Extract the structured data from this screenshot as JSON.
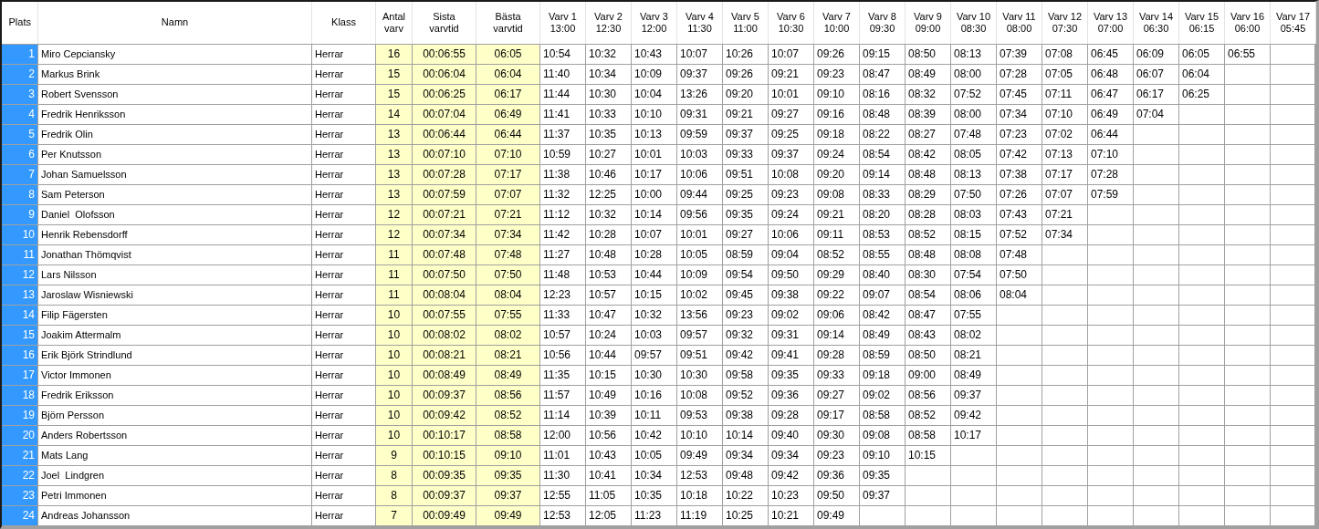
{
  "table": {
    "columns": [
      {
        "kind": "rowhead",
        "lines": [
          "Plats"
        ]
      },
      {
        "kind": "text",
        "lines": [
          "Namn"
        ]
      },
      {
        "kind": "text",
        "lines": [
          "Klass"
        ]
      },
      {
        "kind": "stat",
        "lines": [
          "Antal",
          "varv"
        ]
      },
      {
        "kind": "stat",
        "lines": [
          "Sista",
          "varvtid"
        ]
      },
      {
        "kind": "stat",
        "lines": [
          "Bästa",
          "varvtid"
        ]
      },
      {
        "kind": "lap",
        "lines": [
          "Varv 1",
          "13:00"
        ]
      },
      {
        "kind": "lap",
        "lines": [
          "Varv 2",
          "12:30"
        ]
      },
      {
        "kind": "lap",
        "lines": [
          "Varv 3",
          "12:00"
        ]
      },
      {
        "kind": "lap",
        "lines": [
          "Varv 4",
          "11:30"
        ]
      },
      {
        "kind": "lap",
        "lines": [
          "Varv 5",
          "11:00"
        ]
      },
      {
        "kind": "lap",
        "lines": [
          "Varv 6",
          "10:30"
        ]
      },
      {
        "kind": "lap",
        "lines": [
          "Varv 7",
          "10:00"
        ]
      },
      {
        "kind": "lap",
        "lines": [
          "Varv 8",
          "09:30"
        ]
      },
      {
        "kind": "lap",
        "lines": [
          "Varv 9",
          "09:00"
        ]
      },
      {
        "kind": "lap",
        "lines": [
          "Varv 10",
          "08:30"
        ]
      },
      {
        "kind": "lap",
        "lines": [
          "Varv 11",
          "08:00"
        ]
      },
      {
        "kind": "lap",
        "lines": [
          "Varv 12",
          "07:30"
        ]
      },
      {
        "kind": "lap",
        "lines": [
          "Varv 13",
          "07:00"
        ]
      },
      {
        "kind": "lap",
        "lines": [
          "Varv 14",
          "06:30"
        ]
      },
      {
        "kind": "lap",
        "lines": [
          "Varv 15",
          "06:15"
        ]
      },
      {
        "kind": "lap",
        "lines": [
          "Varv 16",
          "06:00"
        ]
      },
      {
        "kind": "lap",
        "lines": [
          "Varv 17",
          "05:45"
        ]
      }
    ],
    "rows": [
      {
        "place": "1",
        "name": "Miro Cepciansky",
        "class": "Herrar",
        "laps": "16",
        "last": "00:06:55",
        "best": "06:05",
        "splits": [
          "10:54",
          "10:32",
          "10:43",
          "10:07",
          "10:26",
          "10:07",
          "09:26",
          "09:15",
          "08:50",
          "08:13",
          "07:39",
          "07:08",
          "06:45",
          "06:09",
          "06:05",
          "06:55"
        ]
      },
      {
        "place": "2",
        "name": "Markus Brink",
        "class": "Herrar",
        "laps": "15",
        "last": "00:06:04",
        "best": "06:04",
        "splits": [
          "11:40",
          "10:34",
          "10:09",
          "09:37",
          "09:26",
          "09:21",
          "09:23",
          "08:47",
          "08:49",
          "08:00",
          "07:28",
          "07:05",
          "06:48",
          "06:07",
          "06:04"
        ]
      },
      {
        "place": "3",
        "name": "Robert Svensson",
        "class": "Herrar",
        "laps": "15",
        "last": "00:06:25",
        "best": "06:17",
        "splits": [
          "11:44",
          "10:30",
          "10:04",
          "13:26",
          "09:20",
          "10:01",
          "09:10",
          "08:16",
          "08:32",
          "07:52",
          "07:45",
          "07:11",
          "06:47",
          "06:17",
          "06:25"
        ]
      },
      {
        "place": "4",
        "name": "Fredrik Henriksson",
        "class": "Herrar",
        "laps": "14",
        "last": "00:07:04",
        "best": "06:49",
        "splits": [
          "11:41",
          "10:33",
          "10:10",
          "09:31",
          "09:21",
          "09:27",
          "09:16",
          "08:48",
          "08:39",
          "08:00",
          "07:34",
          "07:10",
          "06:49",
          "07:04"
        ]
      },
      {
        "place": "5",
        "name": "Fredrik Olin",
        "class": "Herrar",
        "laps": "13",
        "last": "00:06:44",
        "best": "06:44",
        "splits": [
          "11:37",
          "10:35",
          "10:13",
          "09:59",
          "09:37",
          "09:25",
          "09:18",
          "08:22",
          "08:27",
          "07:48",
          "07:23",
          "07:02",
          "06:44"
        ]
      },
      {
        "place": "6",
        "name": "Per Knutsson",
        "class": "Herrar",
        "laps": "13",
        "last": "00:07:10",
        "best": "07:10",
        "splits": [
          "10:59",
          "10:27",
          "10:01",
          "10:03",
          "09:33",
          "09:37",
          "09:24",
          "08:54",
          "08:42",
          "08:05",
          "07:42",
          "07:13",
          "07:10"
        ]
      },
      {
        "place": "7",
        "name": "Johan Samuelsson",
        "class": "Herrar",
        "laps": "13",
        "last": "00:07:28",
        "best": "07:17",
        "splits": [
          "11:38",
          "10:46",
          "10:17",
          "10:06",
          "09:51",
          "10:08",
          "09:20",
          "09:14",
          "08:48",
          "08:13",
          "07:38",
          "07:17",
          "07:28"
        ]
      },
      {
        "place": "8",
        "name": "Sam Peterson",
        "class": "Herrar",
        "laps": "13",
        "last": "00:07:59",
        "best": "07:07",
        "splits": [
          "11:32",
          "12:25",
          "10:00",
          "09:44",
          "09:25",
          "09:23",
          "09:08",
          "08:33",
          "08:29",
          "07:50",
          "07:26",
          "07:07",
          "07:59"
        ]
      },
      {
        "place": "9",
        "name": "Daniel  Olofsson",
        "class": "Herrar",
        "laps": "12",
        "last": "00:07:21",
        "best": "07:21",
        "splits": [
          "11:12",
          "10:32",
          "10:14",
          "09:56",
          "09:35",
          "09:24",
          "09:21",
          "08:20",
          "08:28",
          "08:03",
          "07:43",
          "07:21"
        ]
      },
      {
        "place": "10",
        "name": "Henrik Rebensdorff",
        "class": "Herrar",
        "laps": "12",
        "last": "00:07:34",
        "best": "07:34",
        "splits": [
          "11:42",
          "10:28",
          "10:07",
          "10:01",
          "09:27",
          "10:06",
          "09:11",
          "08:53",
          "08:52",
          "08:15",
          "07:52",
          "07:34"
        ]
      },
      {
        "place": "11",
        "name": "Jonathan Thömqvist",
        "class": "Herrar",
        "laps": "11",
        "last": "00:07:48",
        "best": "07:48",
        "splits": [
          "11:27",
          "10:48",
          "10:28",
          "10:05",
          "08:59",
          "09:04",
          "08:52",
          "08:55",
          "08:48",
          "08:08",
          "07:48"
        ]
      },
      {
        "place": "12",
        "name": "Lars Nilsson",
        "class": "Herrar",
        "laps": "11",
        "last": "00:07:50",
        "best": "07:50",
        "splits": [
          "11:48",
          "10:53",
          "10:44",
          "10:09",
          "09:54",
          "09:50",
          "09:29",
          "08:40",
          "08:30",
          "07:54",
          "07:50"
        ]
      },
      {
        "place": "13",
        "name": "Jaroslaw Wisniewski",
        "class": "Herrar",
        "laps": "11",
        "last": "00:08:04",
        "best": "08:04",
        "splits": [
          "12:23",
          "10:57",
          "10:15",
          "10:02",
          "09:45",
          "09:38",
          "09:22",
          "09:07",
          "08:54",
          "08:06",
          "08:04"
        ]
      },
      {
        "place": "14",
        "name": "Filip Fägersten",
        "class": "Herrar",
        "laps": "10",
        "last": "00:07:55",
        "best": "07:55",
        "splits": [
          "11:33",
          "10:47",
          "10:32",
          "13:56",
          "09:23",
          "09:02",
          "09:06",
          "08:42",
          "08:47",
          "07:55"
        ]
      },
      {
        "place": "15",
        "name": "Joakim Attermalm",
        "class": "Herrar",
        "laps": "10",
        "last": "00:08:02",
        "best": "08:02",
        "splits": [
          "10:57",
          "10:24",
          "10:03",
          "09:57",
          "09:32",
          "09:31",
          "09:14",
          "08:49",
          "08:43",
          "08:02"
        ]
      },
      {
        "place": "16",
        "name": "Erik Björk Strindlund",
        "class": "Herrar",
        "laps": "10",
        "last": "00:08:21",
        "best": "08:21",
        "splits": [
          "10:56",
          "10:44",
          "09:57",
          "09:51",
          "09:42",
          "09:41",
          "09:28",
          "08:59",
          "08:50",
          "08:21"
        ]
      },
      {
        "place": "17",
        "name": "Victor Immonen",
        "class": "Herrar",
        "laps": "10",
        "last": "00:08:49",
        "best": "08:49",
        "splits": [
          "11:35",
          "10:15",
          "10:30",
          "10:30",
          "09:58",
          "09:35",
          "09:33",
          "09:18",
          "09:00",
          "08:49"
        ]
      },
      {
        "place": "18",
        "name": "Fredrik Eriksson",
        "class": "Herrar",
        "laps": "10",
        "last": "00:09:37",
        "best": "08:56",
        "splits": [
          "11:57",
          "10:49",
          "10:16",
          "10:08",
          "09:52",
          "09:36",
          "09:27",
          "09:02",
          "08:56",
          "09:37"
        ]
      },
      {
        "place": "19",
        "name": "Björn Persson",
        "class": "Herrar",
        "laps": "10",
        "last": "00:09:42",
        "best": "08:52",
        "splits": [
          "11:14",
          "10:39",
          "10:11",
          "09:53",
          "09:38",
          "09:28",
          "09:17",
          "08:58",
          "08:52",
          "09:42"
        ]
      },
      {
        "place": "20",
        "name": "Anders Robertsson",
        "class": "Herrar",
        "laps": "10",
        "last": "00:10:17",
        "best": "08:58",
        "splits": [
          "12:00",
          "10:56",
          "10:42",
          "10:10",
          "10:14",
          "09:40",
          "09:30",
          "09:08",
          "08:58",
          "10:17"
        ]
      },
      {
        "place": "21",
        "name": "Mats Lang",
        "class": "Herrar",
        "laps": "9",
        "last": "00:10:15",
        "best": "09:10",
        "splits": [
          "11:01",
          "10:43",
          "10:05",
          "09:49",
          "09:34",
          "09:34",
          "09:23",
          "09:10",
          "10:15"
        ]
      },
      {
        "place": "22",
        "name": "Joel  Lindgren",
        "class": "Herrar",
        "laps": "8",
        "last": "00:09:35",
        "best": "09:35",
        "splits": [
          "11:30",
          "10:41",
          "10:34",
          "12:53",
          "09:48",
          "09:42",
          "09:36",
          "09:35"
        ]
      },
      {
        "place": "23",
        "name": "Petri Immonen",
        "class": "Herrar",
        "laps": "8",
        "last": "00:09:37",
        "best": "09:37",
        "splits": [
          "12:55",
          "11:05",
          "10:35",
          "10:18",
          "10:22",
          "10:23",
          "09:50",
          "09:37"
        ]
      },
      {
        "place": "24",
        "name": "Andreas Johansson",
        "class": "Herrar",
        "laps": "7",
        "last": "00:09:49",
        "best": "09:49",
        "splits": [
          "12:53",
          "12:05",
          "11:23",
          "11:19",
          "10:25",
          "10:21",
          "09:49"
        ]
      }
    ]
  }
}
